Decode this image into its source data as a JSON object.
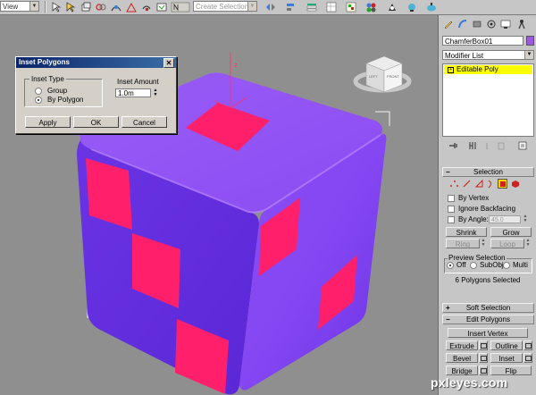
{
  "toolbar": {
    "view_dropdown": "View",
    "selection_set_placeholder": "Create Selection Se",
    "icons": [
      "select-link-icon",
      "unlink-icon",
      "bind-spacewarp-icon",
      "selection-filter-icon",
      "select-object-icon",
      "select-by-name-icon",
      "rect-selection-icon",
      "window-crossing-icon",
      "select-move-icon",
      "select-rotate-icon",
      "select-scale-icon",
      "reference-coord-icon",
      "pivot-center-icon",
      "snap-toggle-icon",
      "angle-snap-icon",
      "percent-snap-icon",
      "spinner-snap-icon",
      "named-selection-icon",
      "mirror-icon",
      "align-icon",
      "layer-manager-icon",
      "curve-editor-icon",
      "schematic-view-icon",
      "material-editor-icon",
      "render-setup-icon",
      "render-frame-icon",
      "quick-render-icon"
    ]
  },
  "dialog": {
    "title": "Inset Polygons",
    "inset_type_label": "Inset Type",
    "options": [
      {
        "label": "Group",
        "selected": false
      },
      {
        "label": "By Polygon",
        "selected": true
      }
    ],
    "inset_amount_label": "Inset Amount",
    "inset_amount_value": "1.0m",
    "buttons": {
      "apply": "Apply",
      "ok": "OK",
      "cancel": "Cancel"
    }
  },
  "viewcube": {
    "left_face": "LEFT",
    "front_face": "FRONT",
    "axis_label": "z"
  },
  "panel": {
    "object_name": "ChamferBox01",
    "object_color": "#9b59e0",
    "modifier_list": "Modifier List",
    "stack_item": "Editable Poly",
    "selection_rollout": "Selection",
    "by_vertex": "By Vertex",
    "ignore_backfacing": "Ignore Backfacing",
    "by_angle": "By Angle:",
    "angle_value": "45.0",
    "shrink": "Shrink",
    "grow": "Grow",
    "ring": "Ring",
    "loop": "Loop",
    "preview_selection": "Preview Selection",
    "preview_options": [
      {
        "label": "Off",
        "selected": true
      },
      {
        "label": "SubObj",
        "selected": false
      },
      {
        "label": "Multi",
        "selected": false
      }
    ],
    "status": "6 Polygons Selected",
    "soft_selection": "Soft Selection",
    "edit_polygons": "Edit Polygons",
    "insert_vertex": "Insert Vertex",
    "extrude": "Extrude",
    "outline": "Outline",
    "bevel": "Bevel",
    "inset": "Inset",
    "bridge": "Bridge",
    "flip": "Flip"
  },
  "colors": {
    "cube": "#7f3ff2",
    "selected_faces": "#ff1f6a",
    "background": "#8f8f8f"
  },
  "watermark": "pxleyes.com"
}
